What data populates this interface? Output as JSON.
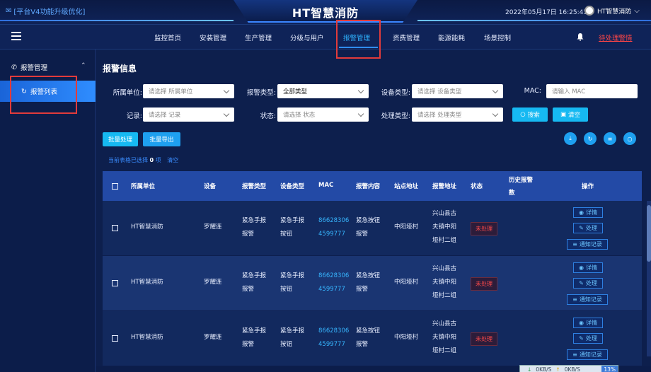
{
  "header": {
    "notice": "[平台V4功能升级优化]",
    "title": "HT智慧消防",
    "datetime": "2022年05月17日 16:25:43",
    "user": "HT智慧消防"
  },
  "nav": {
    "items": [
      "监控首页",
      "安装管理",
      "生产管理",
      "分级与用户",
      "报警管理",
      "资费管理",
      "能源能耗",
      "场景控制"
    ],
    "active": "报警管理",
    "pending": "待处理警情"
  },
  "sidebar": {
    "group": "报警管理",
    "item": "报警列表"
  },
  "filters": {
    "section_title": "报警信息",
    "unit_label": "所属单位:",
    "unit_placeholder": "请选择 所属单位",
    "alarm_type_label": "报警类型:",
    "alarm_type_value": "全部类型",
    "device_type_label": "设备类型:",
    "device_type_placeholder": "请选择 设备类型",
    "mac_label": "MAC:",
    "mac_placeholder": "请输入 MAC",
    "record_label": "记录:",
    "record_placeholder": "请选择 记录",
    "status_label": "状态:",
    "status_placeholder": "请选择 状态",
    "handle_type_label": "处理类型:",
    "handle_type_placeholder": "请选择 处理类型",
    "search_label": "搜索",
    "clear_label": "清空"
  },
  "toolbar": {
    "batch_handle": "批量处理",
    "batch_export": "批量导出",
    "selected_prefix": "当前表格已选择",
    "selected_count": "0",
    "selected_suffix": "项",
    "clear_selection": "清空"
  },
  "table": {
    "headers": [
      "所属单位",
      "设备",
      "报警类型",
      "设备类型",
      "MAC",
      "报警内容",
      "站点地址",
      "报警地址",
      "状态",
      "历史报警",
      "数",
      "操作"
    ],
    "rows": [
      {
        "unit": "HT智慧消防",
        "device": "罗耀连",
        "alarm_type": [
          "紧急手报",
          "报警"
        ],
        "device_type": [
          "紧急手报",
          "按钮"
        ],
        "mac": [
          "86628306",
          "4599777"
        ],
        "content": [
          "紧急按钮",
          "报警"
        ],
        "site": "中阳垭村",
        "address": [
          "兴山县古",
          "夫镇中阳",
          "垭村二组"
        ],
        "status": "未处理"
      },
      {
        "unit": "HT智慧消防",
        "device": "罗耀连",
        "alarm_type": [
          "紧急手报",
          "报警"
        ],
        "device_type": [
          "紧急手报",
          "按钮"
        ],
        "mac": [
          "86628306",
          "4599777"
        ],
        "content": [
          "紧急按钮",
          "报警"
        ],
        "site": "中阳垭村",
        "address": [
          "兴山县古",
          "夫镇中阳",
          "垭村二组"
        ],
        "status": "未处理"
      },
      {
        "unit": "HT智慧消防",
        "device": "罗耀连",
        "alarm_type": [
          "紧急手报",
          "报警"
        ],
        "device_type": [
          "紧急手报",
          "按钮"
        ],
        "mac": [
          "86628306",
          "4599777"
        ],
        "content": [
          "紧急按钮",
          "报警"
        ],
        "site": "中阳垭村",
        "address": [
          "兴山县古",
          "夫镇中阳",
          "垭村二组"
        ],
        "status": "未处理"
      }
    ],
    "actions": {
      "detail": "详情",
      "handle": "处理",
      "notify": "通知记录"
    }
  },
  "netmon": {
    "down": "0KB/S",
    "up": "0KB/S",
    "pct": "13%"
  },
  "colors": {
    "accent": "#2fb3ff",
    "highlight": "#e23b3b",
    "danger": "#ff4a4a"
  }
}
